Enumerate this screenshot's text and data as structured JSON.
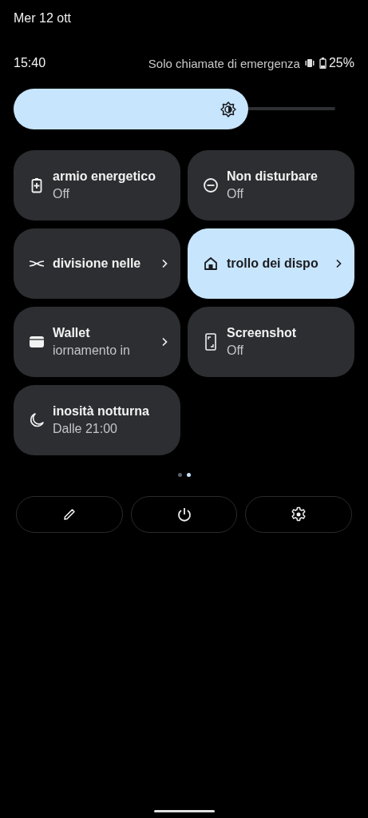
{
  "date": "Mer 12 ott",
  "status_bar": {
    "time": "15:40",
    "carrier": "Solo chiamate di emergenza",
    "vibrate": true,
    "battery": "25%"
  },
  "brightness": {
    "level": 0.73
  },
  "tiles": [
    {
      "kind": "battery",
      "label": "armio energetico",
      "secondary": "Off",
      "chevron": false,
      "on": false
    },
    {
      "kind": "dnd",
      "label": "Non disturbare",
      "secondary": "Off",
      "chevron": false,
      "on": false
    },
    {
      "kind": "share",
      "label": "divisione nelle",
      "chevron": true,
      "on": false
    },
    {
      "kind": "home",
      "label": "trollo dei dispo",
      "chevron": true,
      "on": true
    },
    {
      "kind": "wallet",
      "label": "Wallet",
      "secondary": "iornamento in",
      "chevron": true,
      "on": false
    },
    {
      "kind": "screenshot",
      "label": "Screenshot",
      "secondary": "Off",
      "chevron": false,
      "on": false
    },
    {
      "kind": "moon",
      "label": "inosità notturna",
      "secondary": "Dalle 21:00",
      "chevron": false,
      "on": false
    }
  ],
  "pages": [
    {
      "selected": false
    },
    {
      "selected": true
    }
  ],
  "buttons": [
    {
      "kind": "edit"
    },
    {
      "kind": "power"
    },
    {
      "kind": "settings"
    }
  ]
}
